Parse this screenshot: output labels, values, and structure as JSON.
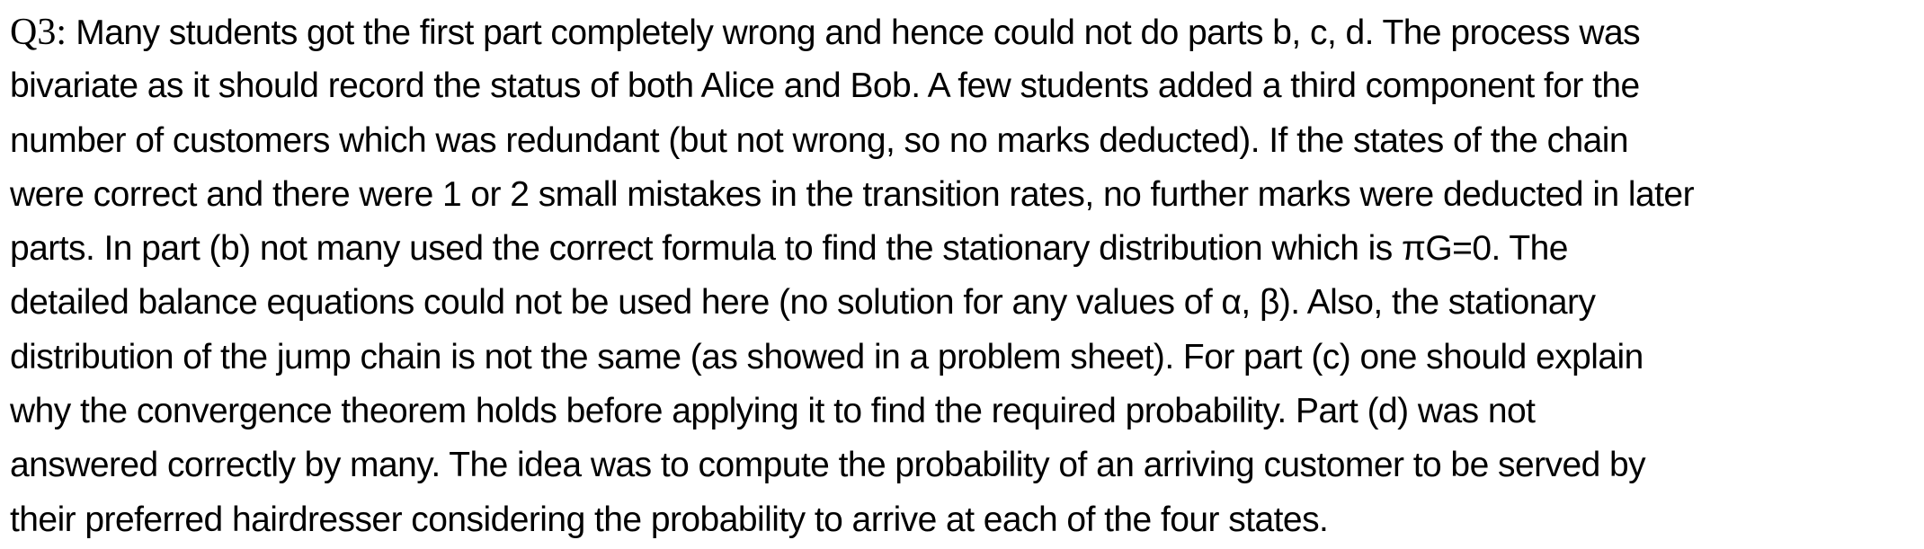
{
  "paragraph": {
    "label": "Q3:",
    "lines": [
      " Many students got the first part completely wrong and hence could not do parts b, c, d. The process was",
      "bivariate as it should record the status of both Alice and Bob. A few students added a third component for the",
      "number of customers which was redundant (but not wrong, so no marks deducted). If the states of the chain",
      "were correct and there were 1 or 2 small mistakes in the transition rates, no further marks were deducted in later",
      "parts. In part (b) not many used the correct formula to find the stationary distribution which is πG=0. The",
      "detailed balance equations could not be used here (no solution for any values of α, β). Also, the stationary",
      "distribution of the jump chain is not the same (as showed in a problem sheet). For part (c) one should explain",
      "why the convergence theorem holds before applying it to find the required probability. Part (d) was not",
      "answered correctly by many. The idea was to compute the probability of an arriving customer to be served by",
      "their preferred hairdresser considering the probability to arrive at each of the four states."
    ]
  }
}
